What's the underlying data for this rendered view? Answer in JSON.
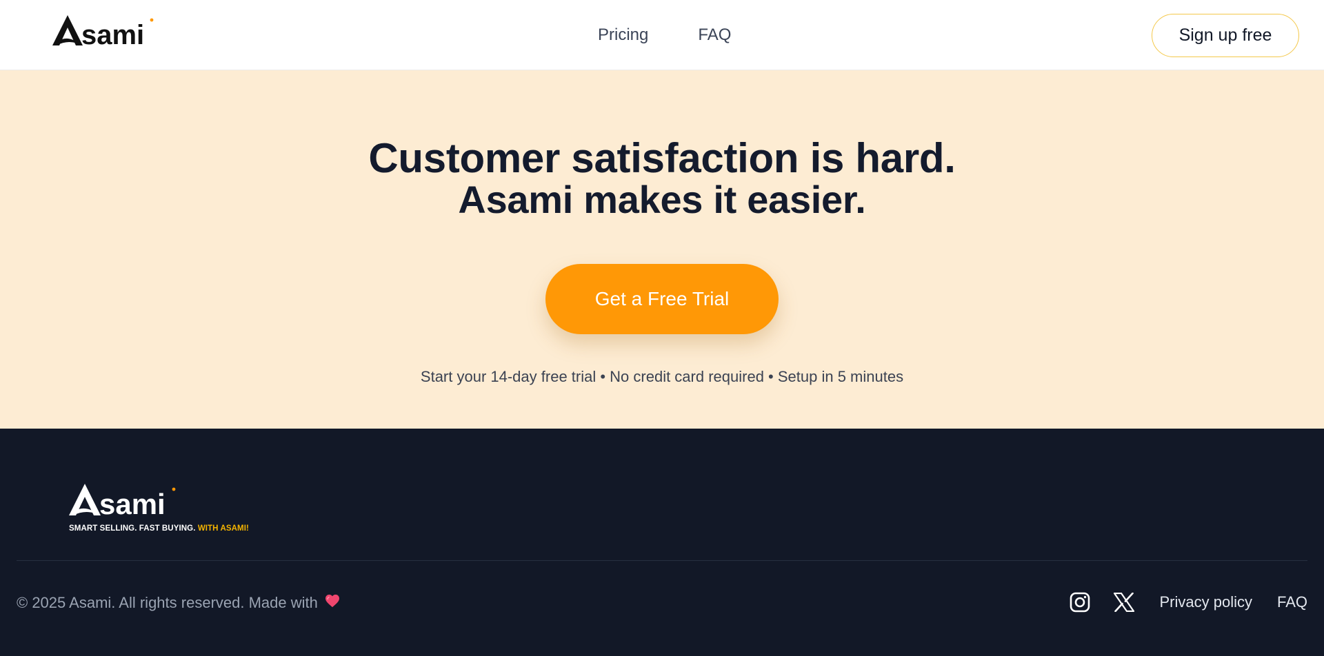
{
  "brand": {
    "name": "Asami",
    "accent_color": "#ff9806",
    "tagline_prefix": "SMART SELLING. FAST BUYING.",
    "tagline_accent": "WITH ASAMI!"
  },
  "header": {
    "logo_text": "sami",
    "nav": [
      {
        "label": "Pricing"
      },
      {
        "label": "FAQ"
      }
    ],
    "signup_label": "Sign up free"
  },
  "hero": {
    "background": "#fdecd3",
    "title_line1": "Customer satisfaction is hard.",
    "title_line2": "Asami makes it easier.",
    "cta_label": "Get a Free Trial",
    "note": "Start your 14-day free trial • No credit card required • Setup in 5 minutes"
  },
  "footer": {
    "background": "#121827",
    "logo_text": "sami",
    "copyright": "© 2025 Asami. All rights reserved. Made with",
    "heart_icon": "heart-icon",
    "social": [
      {
        "icon": "instagram-icon"
      },
      {
        "icon": "x-icon"
      }
    ],
    "links": [
      {
        "label": "Privacy policy"
      },
      {
        "label": "FAQ"
      }
    ]
  }
}
